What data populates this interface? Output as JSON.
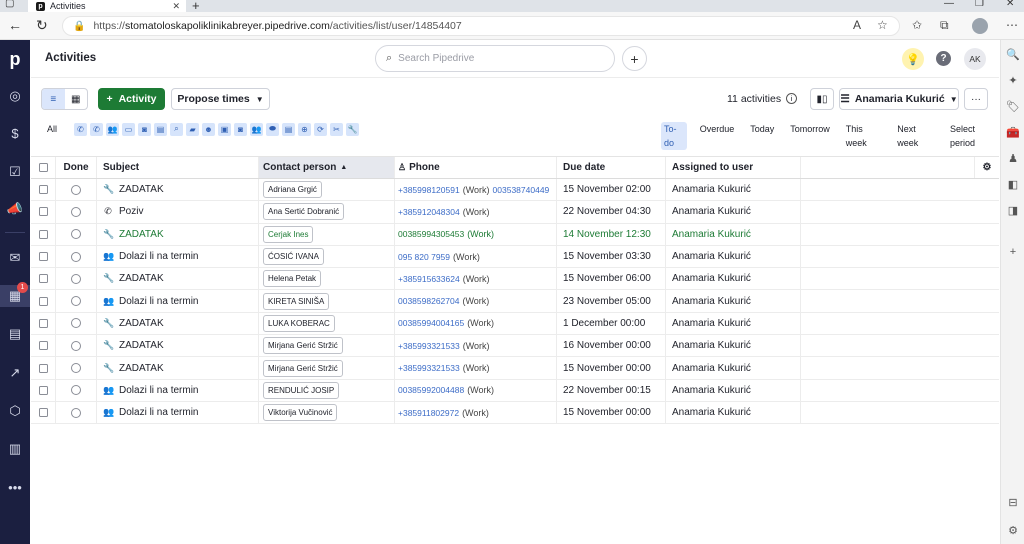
{
  "browser": {
    "tab_title": "Activities",
    "url_prefix": "https://",
    "url_host": "stomatoloskapoliklinikabreyer.pipedrive.com",
    "url_path": "/activities/list/user/14854407",
    "read_aloud_label": "A"
  },
  "header": {
    "title": "Activities",
    "search_placeholder": "Search Pipedrive",
    "avatar_initials": "AK"
  },
  "nav": {
    "logo": "p",
    "scheduler_badge": "1"
  },
  "toolbar": {
    "add_activity_label": "Activity",
    "propose_times_label": "Propose times",
    "count_label": "11 activities",
    "user_filter_label": "Anamaria Kukurić",
    "more_label": "···"
  },
  "filters": {
    "all_label": "All",
    "periods": [
      "To-do",
      "Overdue",
      "Today",
      "Tomorrow",
      "This week",
      "Next week",
      "Select period"
    ],
    "selected_period": "To-do"
  },
  "table": {
    "columns": {
      "done": "Done",
      "subject": "Subject",
      "contact": "Contact person",
      "phone": "Phone",
      "due": "Due date",
      "assigned": "Assigned to user"
    },
    "rows": [
      {
        "type": "task",
        "subject": "ZADATAK",
        "contact": "Adriana Grgić",
        "phone": "+385998120591",
        "work": "(Work)",
        "phone2": "003538740449",
        "due": "15 November 02:00",
        "user": "Anamaria Kukurić"
      },
      {
        "type": "call",
        "subject": "Poziv",
        "contact": "Ana Sertić Dobranić",
        "phone": "+385912048304",
        "work": "(Work)",
        "phone2": "",
        "due": "22 November 04:30",
        "user": "Anamaria Kukurić"
      },
      {
        "type": "task",
        "subject": "ZADATAK",
        "contact": "Cerjak Ines",
        "phone": "00385994305453",
        "work": "(Work)",
        "phone2": "",
        "due": "14 November 12:30",
        "user": "Anamaria Kukurić",
        "highlight": true
      },
      {
        "type": "meeting",
        "subject": "Dolazi li na termin",
        "contact": "ĆOSIĆ IVANA",
        "phone": "095 820 7959",
        "work": "(Work)",
        "phone2": "",
        "due": "15 November 03:30",
        "user": "Anamaria Kukurić"
      },
      {
        "type": "task",
        "subject": "ZADATAK",
        "contact": "Helena Petak",
        "phone": "+385915633624",
        "work": "(Work)",
        "phone2": "",
        "due": "15 November 06:00",
        "user": "Anamaria Kukurić"
      },
      {
        "type": "meeting",
        "subject": "Dolazi li na termin",
        "contact": "KIRETA SINIŠA",
        "phone": "0038598262704",
        "work": "(Work)",
        "phone2": "",
        "due": "23 November 05:00",
        "user": "Anamaria Kukurić"
      },
      {
        "type": "task",
        "subject": "ZADATAK",
        "contact": "LUKA KOBERAC",
        "phone": "00385994004165",
        "work": "(Work)",
        "phone2": "",
        "due": "1 December 00:00",
        "user": "Anamaria Kukurić"
      },
      {
        "type": "task",
        "subject": "ZADATAK",
        "contact": "Mirjana Gerić Stržić",
        "phone": "+385993321533",
        "work": "(Work)",
        "phone2": "",
        "due": "16 November 00:00",
        "user": "Anamaria Kukurić"
      },
      {
        "type": "task",
        "subject": "ZADATAK",
        "contact": "Mirjana Gerić Stržić",
        "phone": "+385993321533",
        "work": "(Work)",
        "phone2": "",
        "due": "15 November 00:00",
        "user": "Anamaria Kukurić"
      },
      {
        "type": "meeting",
        "subject": "Dolazi li na termin",
        "contact": "RENDULIĆ JOSIP",
        "phone": "00385992004488",
        "work": "(Work)",
        "phone2": "",
        "due": "22 November 00:15",
        "user": "Anamaria Kukurić"
      },
      {
        "type": "meeting",
        "subject": "Dolazi li na termin",
        "contact": "Viktorija Vučinović",
        "phone": "+385911802972",
        "work": "(Work)",
        "phone2": "",
        "due": "15 November 00:00",
        "user": "Anamaria Kukurić"
      }
    ]
  },
  "icons": {
    "task": "wrench-icon",
    "call": "phone-icon",
    "meeting": "people-icon"
  },
  "colors": {
    "nav_bg": "#1b1f40",
    "primary_green": "#1d7b35",
    "link_blue": "#3c6cc7",
    "selected_bg": "#dbe6fb"
  }
}
